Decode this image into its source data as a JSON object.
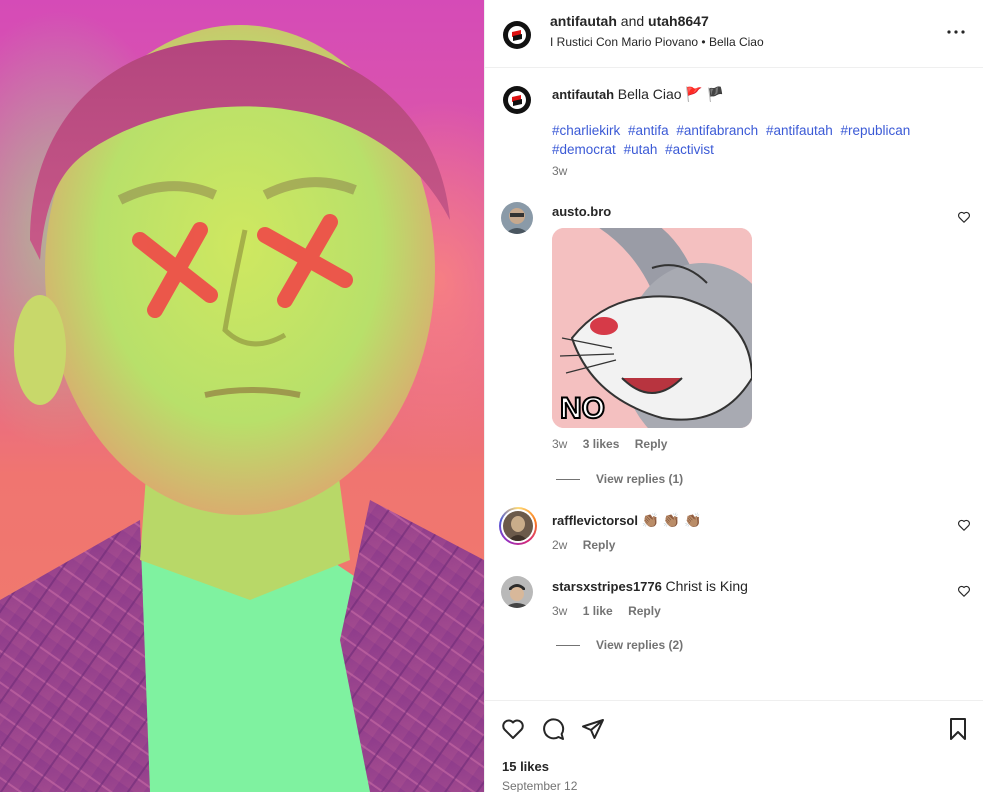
{
  "post": {
    "author": "antifautah",
    "collaborator": "utah8647",
    "joiner": "and",
    "audio": "I Rustici Con Mario Piovano",
    "audio_separator": "•",
    "audio_track": "Bella Ciao"
  },
  "caption": {
    "username": "antifautah",
    "text": "Bella Ciao",
    "flags": "🚩 🏴",
    "hashtags": [
      "#charliekirk",
      "#antifa",
      "#antifabranch",
      "#antifautah",
      "#republican",
      "#democrat",
      "#utah",
      "#activist"
    ],
    "time": "3w"
  },
  "comments": [
    {
      "username": "austo.bro",
      "text": "",
      "gif_text": "NO",
      "time": "3w",
      "likes": "3 likes",
      "reply": "Reply",
      "view_replies": "View replies (1)"
    },
    {
      "username": "rafflevictorsol",
      "text": "👏🏽 👏🏽 👏🏽",
      "time": "2w",
      "reply": "Reply"
    },
    {
      "username": "starsxstripes1776",
      "text": "Christ is King",
      "time": "3w",
      "likes": "1 like",
      "reply": "Reply",
      "view_replies": "View replies (2)"
    }
  ],
  "footer": {
    "likes": "15 likes",
    "date": "September 12"
  },
  "icons": {
    "more": "more-icon",
    "like": "heart-icon",
    "comment": "comment-icon",
    "share": "share-icon",
    "save": "bookmark-icon"
  },
  "colors": {
    "hashtag": "#3b5ad6",
    "muted": "#737373",
    "text": "#262626"
  }
}
